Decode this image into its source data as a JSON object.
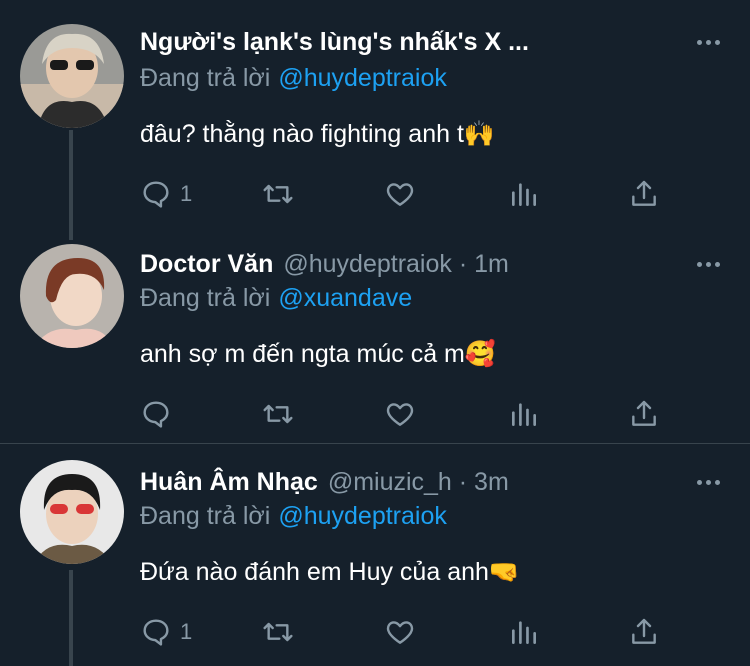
{
  "tweets": [
    {
      "name": "Người's lạnk's lùng's nhấk's X ...",
      "handle": "",
      "time": "",
      "reply_prefix": "Đang trả lời",
      "reply_to": "@huydeptraiok",
      "text": "đâu? thằng nào fighting anh t🙌",
      "reply_count": "1"
    },
    {
      "name": "Doctor Văn",
      "handle": "@huydeptraiok · 1m",
      "reply_prefix": "Đang trả lời",
      "reply_to": "@xuandave",
      "text": "anh sợ m đến ngta múc cả m🥰",
      "reply_count": ""
    },
    {
      "name": "Huân Âm Nhạc",
      "handle": "@miuzic_h · 3m",
      "reply_prefix": "Đang trả lời",
      "reply_to": "@huydeptraiok",
      "text": "Đứa nào đánh em Huy của anh🤜",
      "reply_count": "1"
    }
  ],
  "icons": {
    "reply": "comment-icon",
    "retweet": "retweet-icon",
    "like": "heart-icon",
    "analytics": "analytics-icon",
    "share": "share-icon",
    "more": "more-icon"
  },
  "colors": {
    "background": "#15202b",
    "secondary_text": "#8899a6",
    "link": "#1da1f2",
    "divider": "#38444d"
  }
}
